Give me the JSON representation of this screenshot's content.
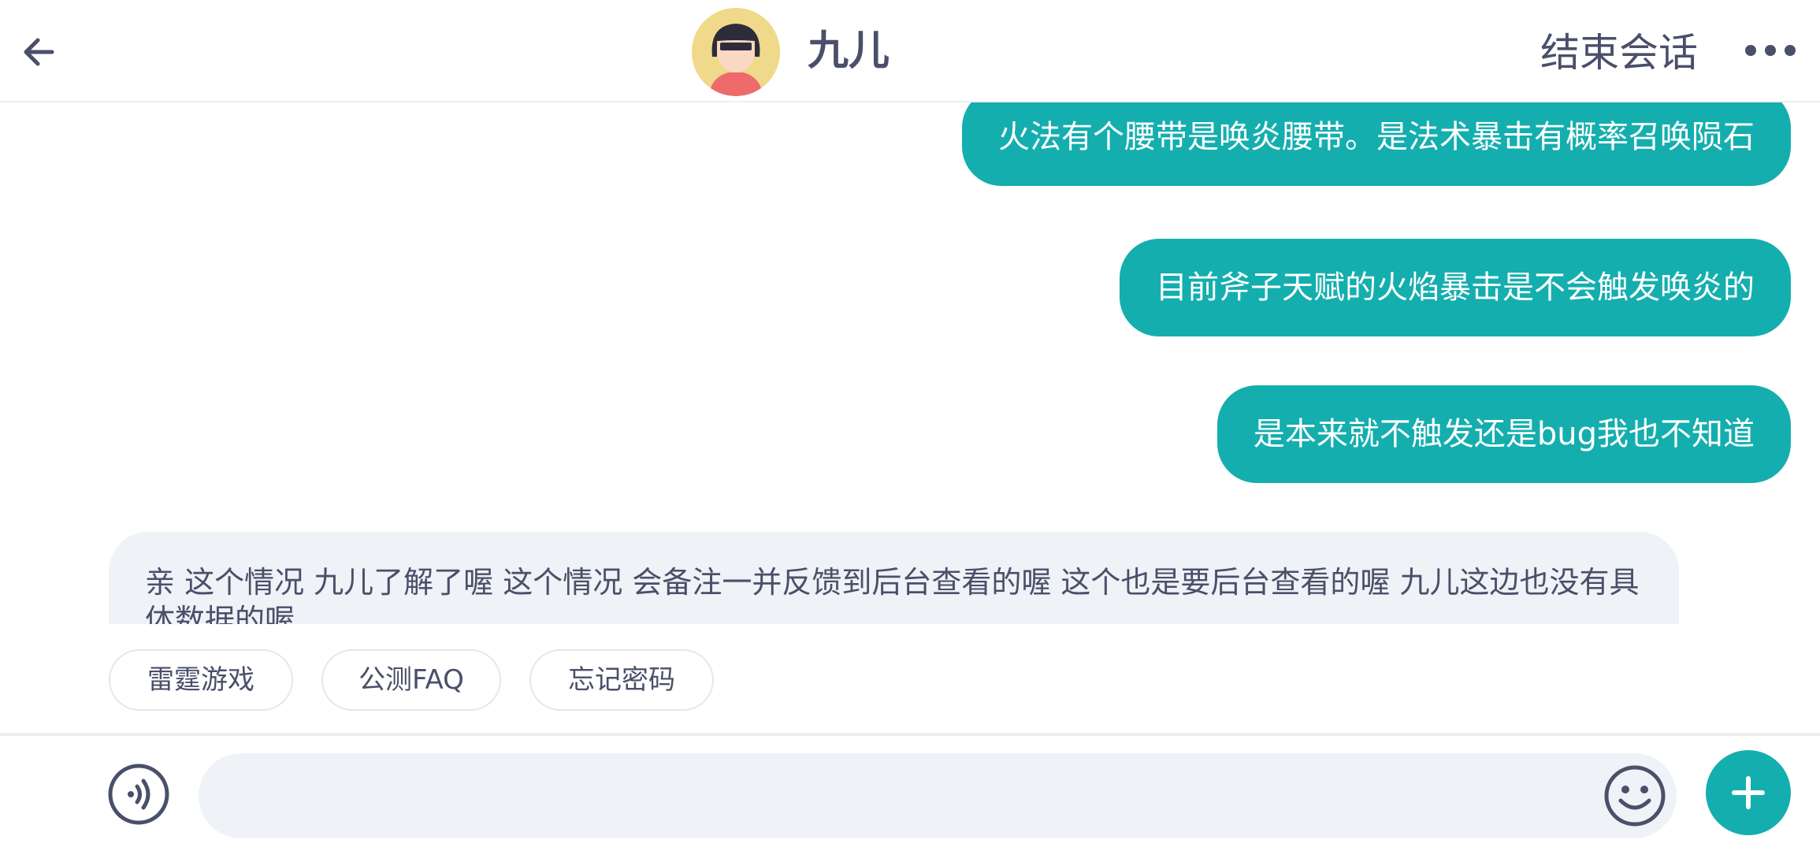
{
  "header": {
    "title": "九儿",
    "end_label": "结束会话",
    "icons": {
      "back": "arrow-left-icon",
      "more": "more-dots-icon",
      "avatar": "agent-avatar"
    }
  },
  "messages": [
    {
      "direction": "out",
      "text": "火法有个腰带是唤炎腰带。是法术暴击有概率召唤陨石"
    },
    {
      "direction": "out",
      "text": "目前斧子天赋的火焰暴击是不会触发唤炎的"
    },
    {
      "direction": "out",
      "text": "是本来就不触发还是bug我也不知道"
    },
    {
      "direction": "in",
      "text": "亲 这个情况 九儿了解了喔 这个情况 会备注一并反馈到后台查看的喔 这个也是要后台查看的喔 九儿这边也没有具体数据的喔"
    }
  ],
  "quick_replies": [
    "雷霆游戏",
    "公测FAQ",
    "忘记密码"
  ],
  "input": {
    "value": "",
    "placeholder": "",
    "icons": {
      "voice": "voice-icon",
      "emoji": "emoji-icon",
      "add": "plus-icon"
    }
  },
  "colors": {
    "accent": "#15aeae",
    "text": "#4a4f6a",
    "bubble_in": "#eff2f6"
  }
}
